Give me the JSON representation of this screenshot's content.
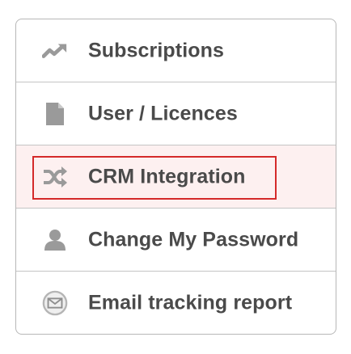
{
  "menu": {
    "items": [
      {
        "label": "Subscriptions",
        "icon": "trending-up-icon"
      },
      {
        "label": "User / Licences",
        "icon": "document-icon"
      },
      {
        "label": "CRM Integration",
        "icon": "shuffle-icon"
      },
      {
        "label": "Change My Password",
        "icon": "user-icon"
      },
      {
        "label": "Email tracking report",
        "icon": "envelope-circle-icon"
      }
    ],
    "highlight_color": "#d42a2a",
    "active_background": "#fdf0f0"
  }
}
